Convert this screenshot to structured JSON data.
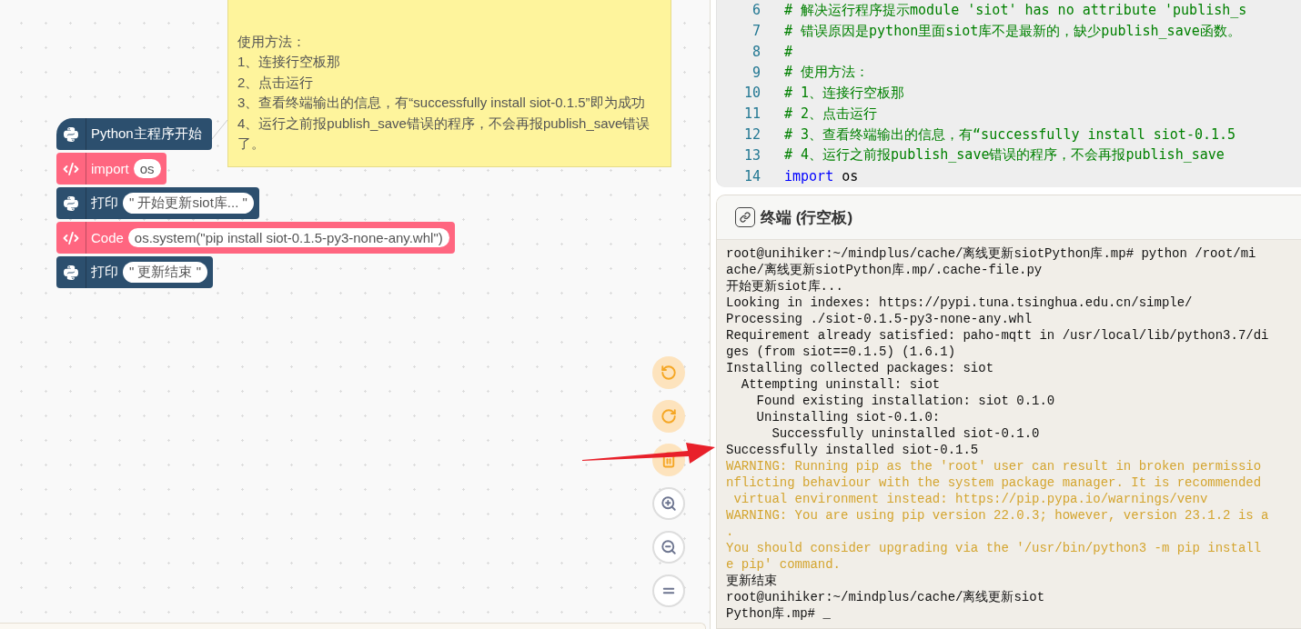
{
  "note": {
    "paragraphs": [
      "使用方法：",
      "1、连接行空板那",
      "2、点击运行",
      "3、查看终端输出的信息，有“successfully install siot-0.1.5”即为成功",
      "4、运行之前报publish_save错误的程序，不会再报publish_save错误了。"
    ]
  },
  "blocks": [
    {
      "kind": "hat",
      "label": "Python主程序开始"
    },
    {
      "kind": "code",
      "label": "import",
      "field": "os"
    },
    {
      "kind": "python",
      "label": "打印",
      "field": "\" 开始更新siot库... \""
    },
    {
      "kind": "code",
      "label": "Code",
      "field": "os.system(\"pip install siot-0.1.5-py3-none-any.whl\")"
    },
    {
      "kind": "python",
      "label": "打印",
      "field": "\" 更新结束 \""
    }
  ],
  "canvas_controls": [
    {
      "kind": "undo"
    },
    {
      "kind": "redo"
    },
    {
      "kind": "trash"
    },
    {
      "kind": "zoom_in"
    },
    {
      "kind": "zoom_out"
    },
    {
      "kind": "reset"
    }
  ],
  "editor": {
    "lines": [
      {
        "number": "6",
        "tokens": [
          {
            "kind": "comment",
            "text": "# 解决运行程序提示module 'siot' has no attribute 'publish_s"
          }
        ]
      },
      {
        "number": "7",
        "tokens": [
          {
            "kind": "comment",
            "text": "# 错误原因是python里面siot库不是最新的，缺少publish_save函数。"
          }
        ]
      },
      {
        "number": "8",
        "tokens": [
          {
            "kind": "comment",
            "text": "#"
          }
        ]
      },
      {
        "number": "9",
        "tokens": [
          {
            "kind": "comment",
            "text": "# 使用方法："
          }
        ]
      },
      {
        "number": "10",
        "tokens": [
          {
            "kind": "comment",
            "text": "# 1、连接行空板那"
          }
        ]
      },
      {
        "number": "11",
        "tokens": [
          {
            "kind": "comment",
            "text": "# 2、点击运行"
          }
        ]
      },
      {
        "number": "12",
        "tokens": [
          {
            "kind": "comment",
            "text": "# 3、查看终端输出的信息，有“successfully install siot-0.1.5"
          }
        ]
      },
      {
        "number": "13",
        "tokens": [
          {
            "kind": "comment",
            "text": "# 4、运行之前报publish_save错误的程序，不会再报publish_save"
          }
        ]
      },
      {
        "number": "14",
        "tokens": [
          {
            "kind": "keyword",
            "text": "import"
          },
          {
            "kind": "plain",
            "text": " os"
          }
        ]
      }
    ]
  },
  "terminal": {
    "title": "终端 (行空板)",
    "lines": [
      {
        "kind": "normal",
        "text": "root@unihiker:~/mindplus/cache/离线更新siotPython库.mp# python /root/mi"
      },
      {
        "kind": "normal",
        "text": "ache/离线更新siotPython库.mp/.cache-file.py"
      },
      {
        "kind": "normal",
        "text": "开始更新siot库..."
      },
      {
        "kind": "normal",
        "text": "Looking in indexes: https://pypi.tuna.tsinghua.edu.cn/simple/"
      },
      {
        "kind": "normal",
        "text": "Processing ./siot-0.1.5-py3-none-any.whl"
      },
      {
        "kind": "normal",
        "text": "Requirement already satisfied: paho-mqtt in /usr/local/lib/python3.7/di"
      },
      {
        "kind": "normal",
        "text": "ges (from siot==0.1.5) (1.6.1)"
      },
      {
        "kind": "normal",
        "text": "Installing collected packages: siot"
      },
      {
        "kind": "normal",
        "text": "  Attempting uninstall: siot"
      },
      {
        "kind": "normal",
        "text": "    Found existing installation: siot 0.1.0"
      },
      {
        "kind": "normal",
        "text": "    Uninstalling siot-0.1.0:"
      },
      {
        "kind": "normal",
        "text": "      Successfully uninstalled siot-0.1.0"
      },
      {
        "kind": "normal",
        "text": "Successfully installed siot-0.1.5"
      },
      {
        "kind": "warning",
        "text": "WARNING: Running pip as the 'root' user can result in broken permissio"
      },
      {
        "kind": "warning",
        "text": "nflicting behaviour with the system package manager. It is recommended"
      },
      {
        "kind": "warning",
        "text": " virtual environment instead: https://pip.pypa.io/warnings/venv"
      },
      {
        "kind": "warning",
        "text": "WARNING: You are using pip version 22.0.3; however, version 23.1.2 is a"
      },
      {
        "kind": "warning",
        "text": "."
      },
      {
        "kind": "warning",
        "text": "You should consider upgrading via the '/usr/bin/python3 -m pip install"
      },
      {
        "kind": "warning",
        "text": "e pip' command."
      },
      {
        "kind": "normal",
        "text": "更新结束"
      },
      {
        "kind": "normal",
        "text": "root@unihiker:~/mindplus/cache/离线更新siot"
      },
      {
        "kind": "normal",
        "text": "Python库.mp# _"
      }
    ]
  }
}
